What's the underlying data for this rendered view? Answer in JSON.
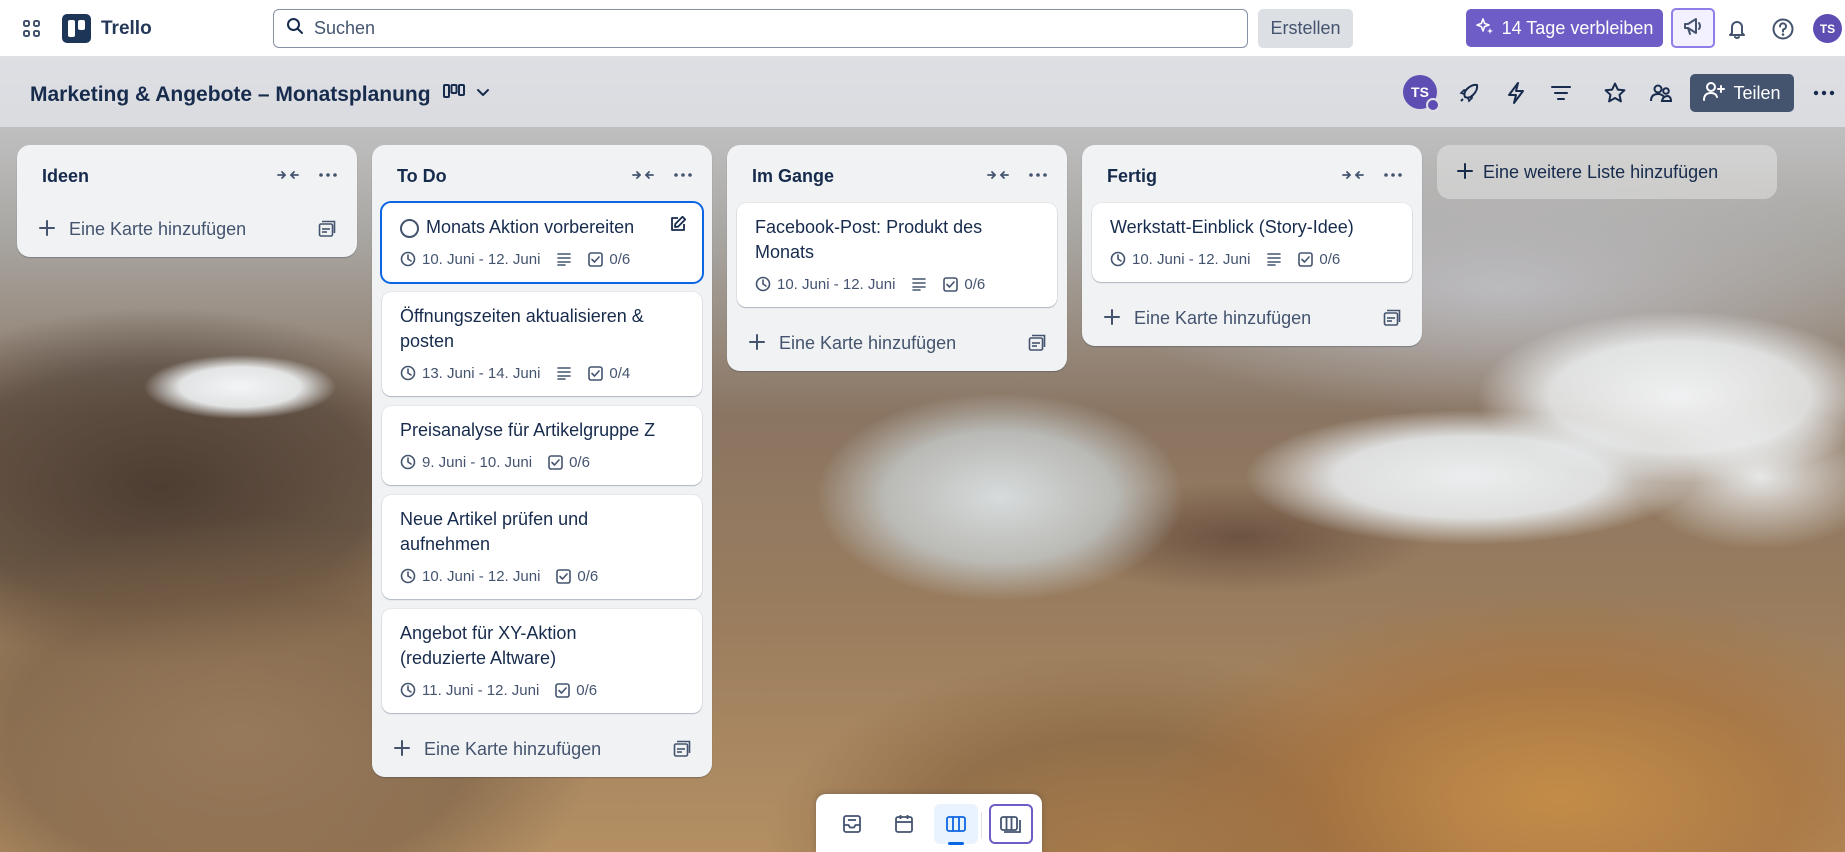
{
  "topbar": {
    "app_name": "Trello",
    "search_placeholder": "Suchen",
    "create_label": "Erstellen",
    "trial_label": "14 Tage verbleiben",
    "avatar_initials": "TS",
    "icons": [
      "apps-grid-icon",
      "trello-logo",
      "search-icon",
      "sparkle-icon",
      "megaphone-icon",
      "bell-icon",
      "help-icon"
    ]
  },
  "board": {
    "title": "Marketing & Angebote – Monatsplanung",
    "member_initials": "TS",
    "share_label": "Teilen",
    "icons": [
      "board-view-icon",
      "chevron-down-icon",
      "power-ups-icon",
      "automation-icon",
      "filter-icon",
      "star-icon",
      "visibility-icon",
      "add-member-icon",
      "more-icon"
    ]
  },
  "lists": [
    {
      "title": "Ideen",
      "cards": [],
      "add_card_label": "Eine Karte hinzufügen"
    },
    {
      "title": "To Do",
      "cards": [
        {
          "title": "Monats Aktion vorbereiten",
          "dates": "10. Juni - 12. Juni",
          "description": true,
          "checklist": "0/6",
          "active": true
        },
        {
          "title": "Öffnungszeiten aktualisieren & posten",
          "dates": "13. Juni - 14. Juni",
          "description": true,
          "checklist": "0/4"
        },
        {
          "title": "Preisanalyse für Artikelgruppe Z",
          "dates": "9. Juni - 10. Juni",
          "description": false,
          "checklist": "0/6"
        },
        {
          "title": "Neue Artikel prüfen und aufnehmen",
          "dates": "10. Juni - 12. Juni",
          "description": false,
          "checklist": "0/6"
        },
        {
          "title": "Angebot für XY-Aktion (reduzierte Altware)",
          "dates": "11. Juni - 12. Juni",
          "description": false,
          "checklist": "0/6"
        }
      ],
      "add_card_label": "Eine Karte hinzufügen"
    },
    {
      "title": "Im Gange",
      "cards": [
        {
          "title": "Facebook-Post: Produkt des Monats",
          "dates": "10. Juni - 12. Juni",
          "description": true,
          "checklist": "0/6"
        }
      ],
      "add_card_label": "Eine Karte hinzufügen"
    },
    {
      "title": "Fertig",
      "cards": [
        {
          "title": "Werkstatt-Einblick (Story-Idee)",
          "dates": "10. Juni - 12. Juni",
          "description": true,
          "checklist": "0/6"
        }
      ],
      "add_card_label": "Eine Karte hinzufügen"
    }
  ],
  "add_list_label": "Eine weitere Liste hinzufügen",
  "bottom_switcher": {
    "icons": [
      "inbox-icon",
      "calendar-icon",
      "board-icon",
      "switch-boards-icon"
    ],
    "active": "board-icon"
  },
  "colors": {
    "accent": "#0c66e4",
    "trial": "#6e5dc6",
    "avatar": "#5e4db2",
    "share": "#44546f"
  }
}
